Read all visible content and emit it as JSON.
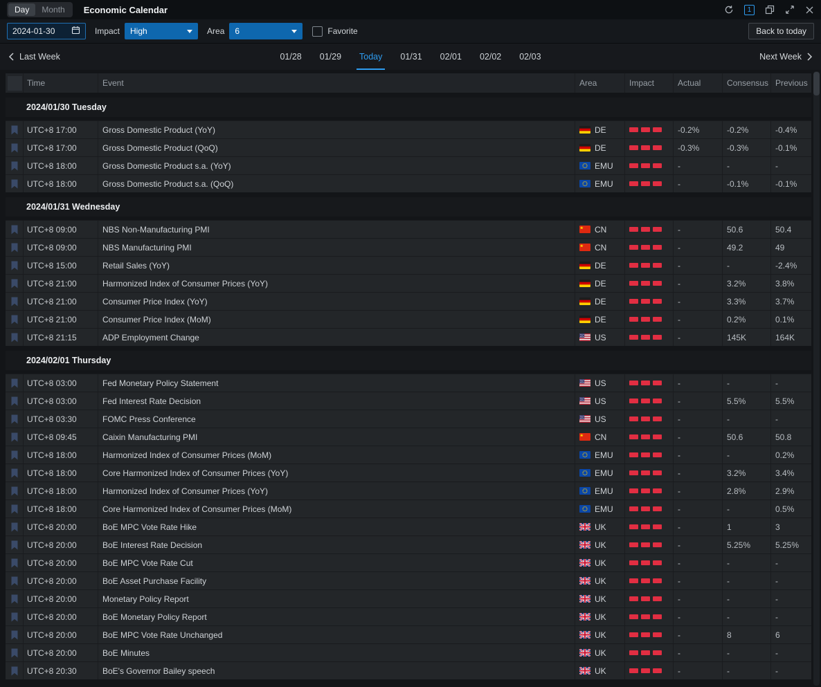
{
  "titlebar": {
    "tabs": [
      {
        "label": "Day",
        "active": true
      },
      {
        "label": "Month",
        "active": false
      }
    ],
    "title": "Economic Calendar",
    "window_badge": "1"
  },
  "filters": {
    "date_value": "2024-01-30",
    "impact_label": "Impact",
    "impact_value": "High",
    "area_label": "Area",
    "area_value": "6",
    "favorite_label": "Favorite",
    "favorite_checked": false,
    "back_to_today_label": "Back to today"
  },
  "week_nav": {
    "prev_label": "Last Week",
    "next_label": "Next Week",
    "days": [
      "01/28",
      "01/29",
      "Today",
      "01/31",
      "02/01",
      "02/02",
      "02/03"
    ],
    "active_day": "Today"
  },
  "table": {
    "headers": [
      "Time",
      "Event",
      "Area",
      "Impact",
      "Actual",
      "Consensus",
      "Previous"
    ]
  },
  "colors": {
    "accent_blue": "#2e9cf0",
    "select_blue": "#0e67ae",
    "impact_red": "#e12e42",
    "row_bg": "#232629",
    "page_bg": "#131518"
  },
  "groups": [
    {
      "date": "2024/01/30 Tuesday",
      "rows": [
        {
          "time": "UTC+8 17:00",
          "event": "Gross Domestic Product (YoY)",
          "area": "DE",
          "impact": 3,
          "actual": "-0.2%",
          "consensus": "-0.2%",
          "previous": "-0.4%"
        },
        {
          "time": "UTC+8 17:00",
          "event": "Gross Domestic Product (QoQ)",
          "area": "DE",
          "impact": 3,
          "actual": "-0.3%",
          "consensus": "-0.3%",
          "previous": "-0.1%"
        },
        {
          "time": "UTC+8 18:00",
          "event": "Gross Domestic Product s.a. (YoY)",
          "area": "EMU",
          "impact": 3,
          "actual": "-",
          "consensus": "-",
          "previous": "-"
        },
        {
          "time": "UTC+8 18:00",
          "event": "Gross Domestic Product s.a. (QoQ)",
          "area": "EMU",
          "impact": 3,
          "actual": "-",
          "consensus": "-0.1%",
          "previous": "-0.1%"
        }
      ]
    },
    {
      "date": "2024/01/31 Wednesday",
      "rows": [
        {
          "time": "UTC+8 09:00",
          "event": "NBS Non-Manufacturing PMI",
          "area": "CN",
          "impact": 3,
          "actual": "-",
          "consensus": "50.6",
          "previous": "50.4"
        },
        {
          "time": "UTC+8 09:00",
          "event": "NBS Manufacturing PMI",
          "area": "CN",
          "impact": 3,
          "actual": "-",
          "consensus": "49.2",
          "previous": "49"
        },
        {
          "time": "UTC+8 15:00",
          "event": "Retail Sales (YoY)",
          "area": "DE",
          "impact": 3,
          "actual": "-",
          "consensus": "-",
          "previous": "-2.4%"
        },
        {
          "time": "UTC+8 21:00",
          "event": "Harmonized Index of Consumer Prices (YoY)",
          "area": "DE",
          "impact": 3,
          "actual": "-",
          "consensus": "3.2%",
          "previous": "3.8%"
        },
        {
          "time": "UTC+8 21:00",
          "event": "Consumer Price Index (YoY)",
          "area": "DE",
          "impact": 3,
          "actual": "-",
          "consensus": "3.3%",
          "previous": "3.7%"
        },
        {
          "time": "UTC+8 21:00",
          "event": "Consumer Price Index (MoM)",
          "area": "DE",
          "impact": 3,
          "actual": "-",
          "consensus": "0.2%",
          "previous": "0.1%"
        },
        {
          "time": "UTC+8 21:15",
          "event": "ADP Employment Change",
          "area": "US",
          "impact": 3,
          "actual": "-",
          "consensus": "145K",
          "previous": "164K"
        }
      ]
    },
    {
      "date": "2024/02/01 Thursday",
      "rows": [
        {
          "time": "UTC+8 03:00",
          "event": "Fed Monetary Policy Statement",
          "area": "US",
          "impact": 3,
          "actual": "-",
          "consensus": "-",
          "previous": "-"
        },
        {
          "time": "UTC+8 03:00",
          "event": "Fed Interest Rate Decision",
          "area": "US",
          "impact": 3,
          "actual": "-",
          "consensus": "5.5%",
          "previous": "5.5%"
        },
        {
          "time": "UTC+8 03:30",
          "event": "FOMC Press Conference",
          "area": "US",
          "impact": 3,
          "actual": "-",
          "consensus": "-",
          "previous": "-"
        },
        {
          "time": "UTC+8 09:45",
          "event": "Caixin Manufacturing PMI",
          "area": "CN",
          "impact": 3,
          "actual": "-",
          "consensus": "50.6",
          "previous": "50.8"
        },
        {
          "time": "UTC+8 18:00",
          "event": "Harmonized Index of Consumer Prices (MoM)",
          "area": "EMU",
          "impact": 3,
          "actual": "-",
          "consensus": "-",
          "previous": "0.2%"
        },
        {
          "time": "UTC+8 18:00",
          "event": "Core Harmonized Index of Consumer Prices (YoY)",
          "area": "EMU",
          "impact": 3,
          "actual": "-",
          "consensus": "3.2%",
          "previous": "3.4%"
        },
        {
          "time": "UTC+8 18:00",
          "event": "Harmonized Index of Consumer Prices (YoY)",
          "area": "EMU",
          "impact": 3,
          "actual": "-",
          "consensus": "2.8%",
          "previous": "2.9%"
        },
        {
          "time": "UTC+8 18:00",
          "event": "Core Harmonized Index of Consumer Prices (MoM)",
          "area": "EMU",
          "impact": 3,
          "actual": "-",
          "consensus": "-",
          "previous": "0.5%"
        },
        {
          "time": "UTC+8 20:00",
          "event": "BoE MPC Vote Rate Hike",
          "area": "UK",
          "impact": 3,
          "actual": "-",
          "consensus": "1",
          "previous": "3"
        },
        {
          "time": "UTC+8 20:00",
          "event": "BoE Interest Rate Decision",
          "area": "UK",
          "impact": 3,
          "actual": "-",
          "consensus": "5.25%",
          "previous": "5.25%"
        },
        {
          "time": "UTC+8 20:00",
          "event": "BoE MPC Vote Rate Cut",
          "area": "UK",
          "impact": 3,
          "actual": "-",
          "consensus": "-",
          "previous": "-"
        },
        {
          "time": "UTC+8 20:00",
          "event": "BoE Asset Purchase Facility",
          "area": "UK",
          "impact": 3,
          "actual": "-",
          "consensus": "-",
          "previous": "-"
        },
        {
          "time": "UTC+8 20:00",
          "event": "Monetary Policy Report",
          "area": "UK",
          "impact": 3,
          "actual": "-",
          "consensus": "-",
          "previous": "-"
        },
        {
          "time": "UTC+8 20:00",
          "event": "BoE Monetary Policy Report",
          "area": "UK",
          "impact": 3,
          "actual": "-",
          "consensus": "-",
          "previous": "-"
        },
        {
          "time": "UTC+8 20:00",
          "event": "BoE MPC Vote Rate Unchanged",
          "area": "UK",
          "impact": 3,
          "actual": "-",
          "consensus": "8",
          "previous": "6"
        },
        {
          "time": "UTC+8 20:00",
          "event": "BoE Minutes",
          "area": "UK",
          "impact": 3,
          "actual": "-",
          "consensus": "-",
          "previous": "-"
        },
        {
          "time": "UTC+8 20:30",
          "event": "BoE's Governor Bailey speech",
          "area": "UK",
          "impact": 3,
          "actual": "-",
          "consensus": "-",
          "previous": "-"
        }
      ]
    }
  ]
}
